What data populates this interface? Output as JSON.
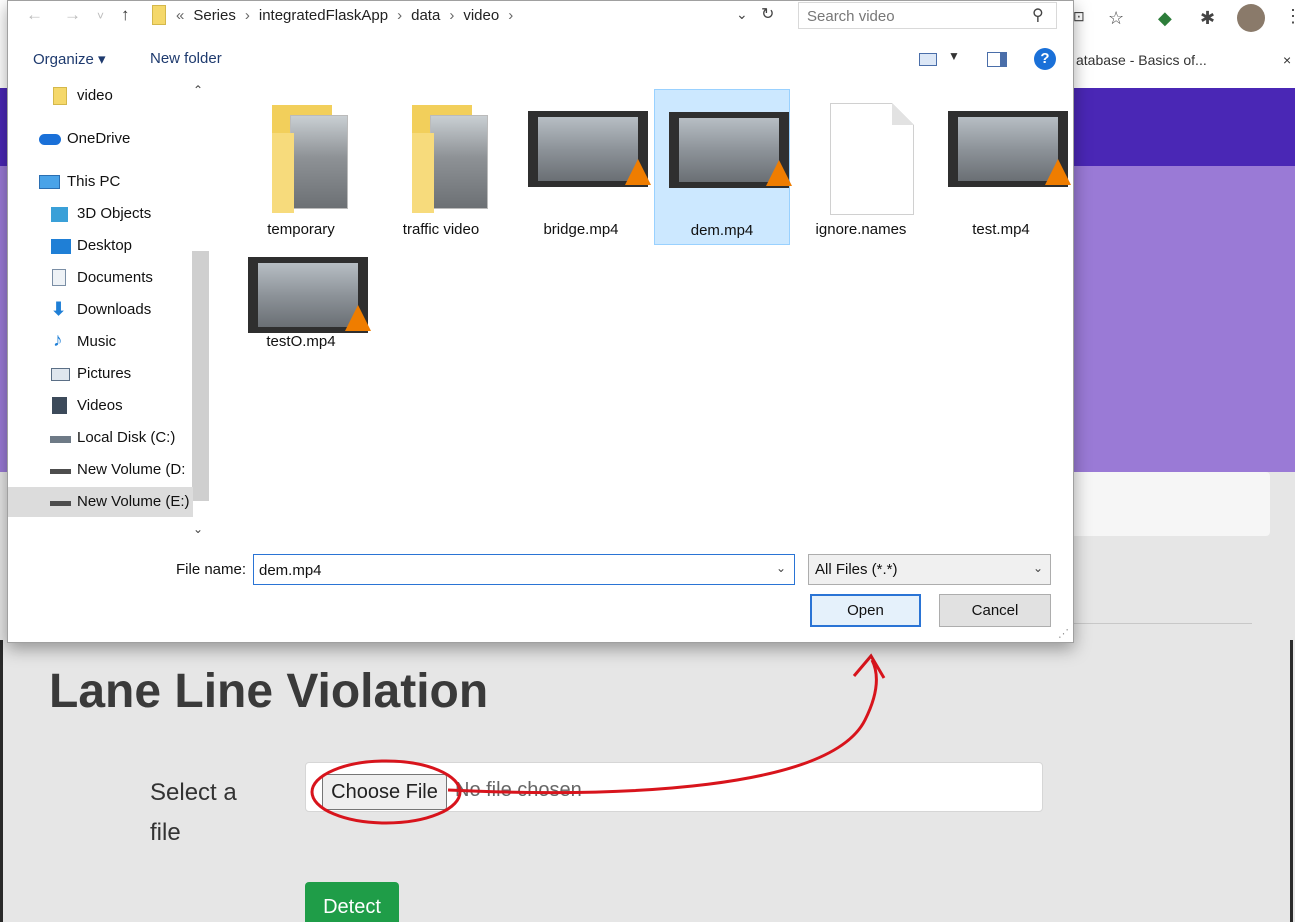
{
  "browser": {
    "bookmark_label": "atabase - Basics of...",
    "bookmark_close": "×",
    "icons": [
      "translate-icon",
      "star-icon",
      "extension-colorful-icon",
      "puzzle-extension-icon",
      "profile-avatar",
      "kebab-menu-icon"
    ],
    "colors": {
      "header": "#4a27b5",
      "banner": "#9a7ad6",
      "page": "#e6e6e6"
    }
  },
  "page": {
    "title": "Lane Line Violation",
    "select_label": "Select a file",
    "choose_file_label": "Choose File",
    "no_file_text": "No file chosen",
    "detect_label": "Detect",
    "detect_color": "#1f9d48"
  },
  "annotation": {
    "color": "#d8141c",
    "shape": "circle-and-arrow"
  },
  "dialog": {
    "nav_back": "←",
    "nav_forward": "→",
    "nav_recent": "˅",
    "nav_up": "↑",
    "breadcrumb_prefix": "«",
    "breadcrumb": [
      "Series",
      "integratedFlaskApp",
      "data",
      "video"
    ],
    "search_placeholder": "Search video",
    "toolbar": {
      "organize": "Organize ▾",
      "new_folder": "New folder",
      "help": "?"
    },
    "nav_items": [
      {
        "label": "video",
        "icon": "folder-icon"
      },
      {
        "label": "OneDrive",
        "icon": "onedrive-cloud-icon"
      },
      {
        "label": "This PC",
        "icon": "this-pc-icon"
      },
      {
        "label": "3D Objects",
        "icon": "3d-objects-icon"
      },
      {
        "label": "Desktop",
        "icon": "desktop-icon"
      },
      {
        "label": "Documents",
        "icon": "documents-icon"
      },
      {
        "label": "Downloads",
        "icon": "downloads-icon"
      },
      {
        "label": "Music",
        "icon": "music-icon"
      },
      {
        "label": "Pictures",
        "icon": "pictures-icon"
      },
      {
        "label": "Videos",
        "icon": "videos-icon"
      },
      {
        "label": "Local Disk (C:)",
        "icon": "local-disk-icon"
      },
      {
        "label": "New Volume (D:",
        "icon": "drive-icon"
      },
      {
        "label": "New Volume (E:)",
        "icon": "drive-icon",
        "selected": true
      }
    ],
    "files": [
      {
        "name": "temporary",
        "type": "folder"
      },
      {
        "name": "traffic video",
        "type": "folder"
      },
      {
        "name": "bridge.mp4",
        "type": "video"
      },
      {
        "name": "dem.mp4",
        "type": "video",
        "selected": true
      },
      {
        "name": "ignore.names",
        "type": "document"
      },
      {
        "name": "test.mp4",
        "type": "video"
      },
      {
        "name": "testO.mp4",
        "type": "video"
      }
    ],
    "filename_label": "File name:",
    "filename_value": "dem.mp4",
    "filetype": "All Files (*.*)",
    "open_label": "Open",
    "cancel_label": "Cancel"
  }
}
